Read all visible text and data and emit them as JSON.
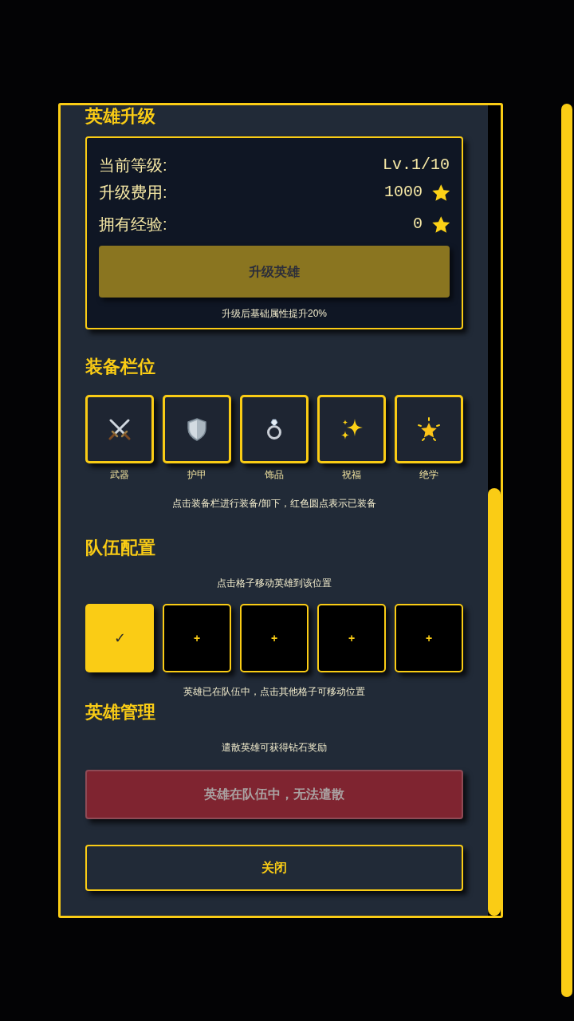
{
  "upgrade": {
    "title": "英雄升级",
    "stats": [
      {
        "label": "当前等级:",
        "value": "Lv.1/10",
        "kind": "plain"
      },
      {
        "label": "升级费用:",
        "value": "1000",
        "kind": "starred"
      },
      {
        "label": "拥有经验:",
        "value": "0",
        "kind": "starred"
      }
    ],
    "button": {
      "label": "升级英雄",
      "disabled": true
    },
    "note": "升级后基础属性提升20%"
  },
  "equipment": {
    "title": "装备栏位",
    "slots": [
      {
        "label": "武器",
        "kind": "weapon"
      },
      {
        "label": "护甲",
        "kind": "armor"
      },
      {
        "label": "饰品",
        "kind": "accessory"
      },
      {
        "label": "祝福",
        "kind": "blessing"
      },
      {
        "label": "绝学",
        "kind": "skill"
      }
    ],
    "note": "点击装备栏进行装备/卸下，红色圆点表示已装备"
  },
  "team": {
    "title": "队伍配置",
    "hint": "点击格子移动英雄到该位置",
    "slots": [
      {
        "label": "✓",
        "selected": true
      },
      {
        "label": "+",
        "selected": false
      },
      {
        "label": "+",
        "selected": false
      },
      {
        "label": "+",
        "selected": false
      },
      {
        "label": "+",
        "selected": false
      }
    ],
    "note": "英雄已在队伍中，点击其他格子可移动位置"
  },
  "management": {
    "title": "英雄管理",
    "hint": "遣散英雄可获得钻石奖励",
    "dismiss_button": {
      "label": "英雄在队伍中，无法遣散",
      "disabled": true
    }
  },
  "close_button": {
    "label": "关闭"
  }
}
